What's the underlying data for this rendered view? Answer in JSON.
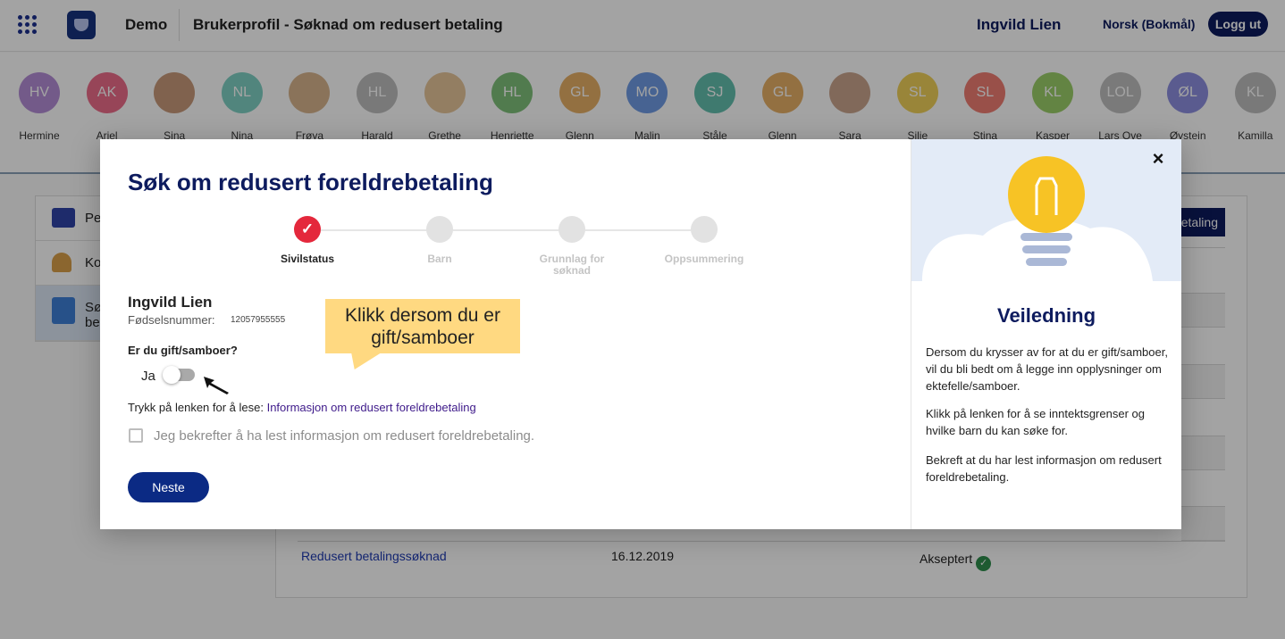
{
  "header": {
    "brand": "Demo",
    "page_title": "Brukerprofil - Søknad om redusert betaling",
    "user_name": "Ingvild Lien",
    "language": "Norsk (Bokmål)",
    "logout_label": "Logg ut"
  },
  "children": [
    {
      "initials": "HV",
      "name": "Hermine",
      "color": "#b58ed6"
    },
    {
      "initials": "AK",
      "name": "Ariel",
      "color": "#ec6c8a"
    },
    {
      "initials": "",
      "name": "Sina",
      "color": "#c99a7a"
    },
    {
      "initials": "NL",
      "name": "Nina",
      "color": "#7fd1c4"
    },
    {
      "initials": "",
      "name": "Frøya",
      "color": "#d8b48e"
    },
    {
      "initials": "HL",
      "name": "Harald",
      "color": "#bdbdbd"
    },
    {
      "initials": "",
      "name": "Grethe",
      "color": "#e6c59a"
    },
    {
      "initials": "HL",
      "name": "Henriette",
      "color": "#7fc07a"
    },
    {
      "initials": "GL",
      "name": "Glenn",
      "color": "#e7b066"
    },
    {
      "initials": "MO",
      "name": "Malin",
      "color": "#6f9ce4"
    },
    {
      "initials": "SJ",
      "name": "Ståle",
      "color": "#63bfae"
    },
    {
      "initials": "GL",
      "name": "Glenn",
      "color": "#e7b066"
    },
    {
      "initials": "",
      "name": "Sara",
      "color": "#caa58e"
    },
    {
      "initials": "SL",
      "name": "Silje",
      "color": "#f0d05a"
    },
    {
      "initials": "SL",
      "name": "Stina",
      "color": "#f07d72"
    },
    {
      "initials": "KL",
      "name": "Kasper",
      "color": "#9ccf6a"
    },
    {
      "initials": "LOL",
      "name": "Lars Ove",
      "color": "#bfbfbf"
    },
    {
      "initials": "ØL",
      "name": "Øystein",
      "color": "#8d8fe0"
    },
    {
      "initials": "KL",
      "name": "Kamilla",
      "color": "#bdbdbd"
    }
  ],
  "sidebar": {
    "items": [
      {
        "label": "Pe"
      },
      {
        "label": "Ko"
      },
      {
        "label": "Sø"
      },
      {
        "label": "be"
      }
    ]
  },
  "background": {
    "button_label": "etaling",
    "application": {
      "link": "Redusert betalingssøknad",
      "date": "16.12.2019",
      "status": "Akseptert"
    }
  },
  "modal": {
    "title": "Søk om redusert foreldrebetaling",
    "steps": [
      {
        "label": "Sivilstatus",
        "done": true
      },
      {
        "label": "Barn",
        "done": false
      },
      {
        "label": "Grunnlag for søknad",
        "done": false
      },
      {
        "label": "Oppsummering",
        "done": false
      }
    ],
    "person_name": "Ingvild Lien",
    "fnr_label": "Fødselsnummer:",
    "fnr_value": "12057955555",
    "question": "Er du gift/samboer?",
    "toggle_label": "Ja",
    "toggle_on": false,
    "tooltip": "Klikk dersom du er gift/samboer",
    "info_prefix": "Trykk på lenken for å lese: ",
    "info_link": "Informasjon om redusert foreldrebetaling",
    "confirm_text": "Jeg bekrefter å ha lest informasjon om redusert foreldrebetaling.",
    "next_label": "Neste"
  },
  "guide": {
    "close_label": "×",
    "title": "Veiledning",
    "paragraphs": [
      "Dersom du krysser av for at du er gift/samboer, vil du bli bedt om å legge inn opplysninger om ektefelle/samboer.",
      "Klikk på lenken for å se inntektsgrenser og hvilke barn du kan søke for.",
      "Bekreft at du har lest informasjon om redusert foreldrebetaling."
    ]
  },
  "colors": {
    "primary": "#0d1b5e",
    "accent_red": "#e4283c",
    "tooltip": "#ffd981",
    "success": "#2f8f4e"
  }
}
